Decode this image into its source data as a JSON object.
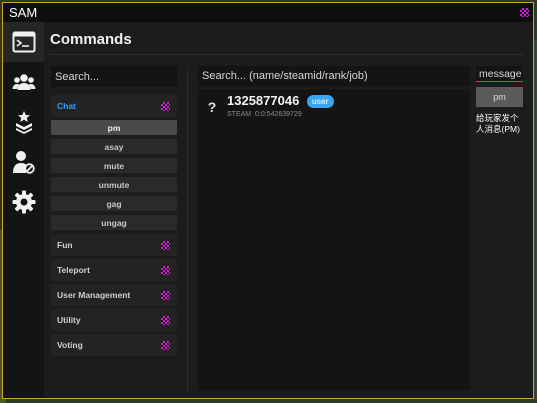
{
  "window": {
    "title": "SAM"
  },
  "sidebar": {
    "items": [
      {
        "icon": "terminal-icon",
        "active": true
      },
      {
        "icon": "users-icon",
        "active": false
      },
      {
        "icon": "ranks-icon",
        "active": false
      },
      {
        "icon": "user-ban-icon",
        "active": false
      },
      {
        "icon": "gear-icon",
        "active": false
      }
    ]
  },
  "header": {
    "title": "Commands"
  },
  "categories": {
    "search_placeholder": "Search...",
    "items": [
      {
        "label": "Chat",
        "expanded": true,
        "commands": [
          "pm",
          "asay",
          "mute",
          "unmute",
          "gag",
          "ungag"
        ],
        "selected": "pm"
      },
      {
        "label": "Fun"
      },
      {
        "label": "Teleport"
      },
      {
        "label": "User Management"
      },
      {
        "label": "Utility"
      },
      {
        "label": "Voting"
      }
    ]
  },
  "players": {
    "search_placeholder": "Search... (name/steamid/rank/job)",
    "rows": [
      {
        "name": "1325877046",
        "rank": "user",
        "steamid": "STEAM_0:0:542639729"
      }
    ]
  },
  "args": {
    "message_placeholder": "message",
    "run_label": "pm",
    "help_text": "给玩家发个人消息(PM)"
  },
  "colors": {
    "accent": "#2fa3ff",
    "badge": "#3aa6f0",
    "border": "#d4a12a",
    "error_underline": "#e23c3c"
  }
}
